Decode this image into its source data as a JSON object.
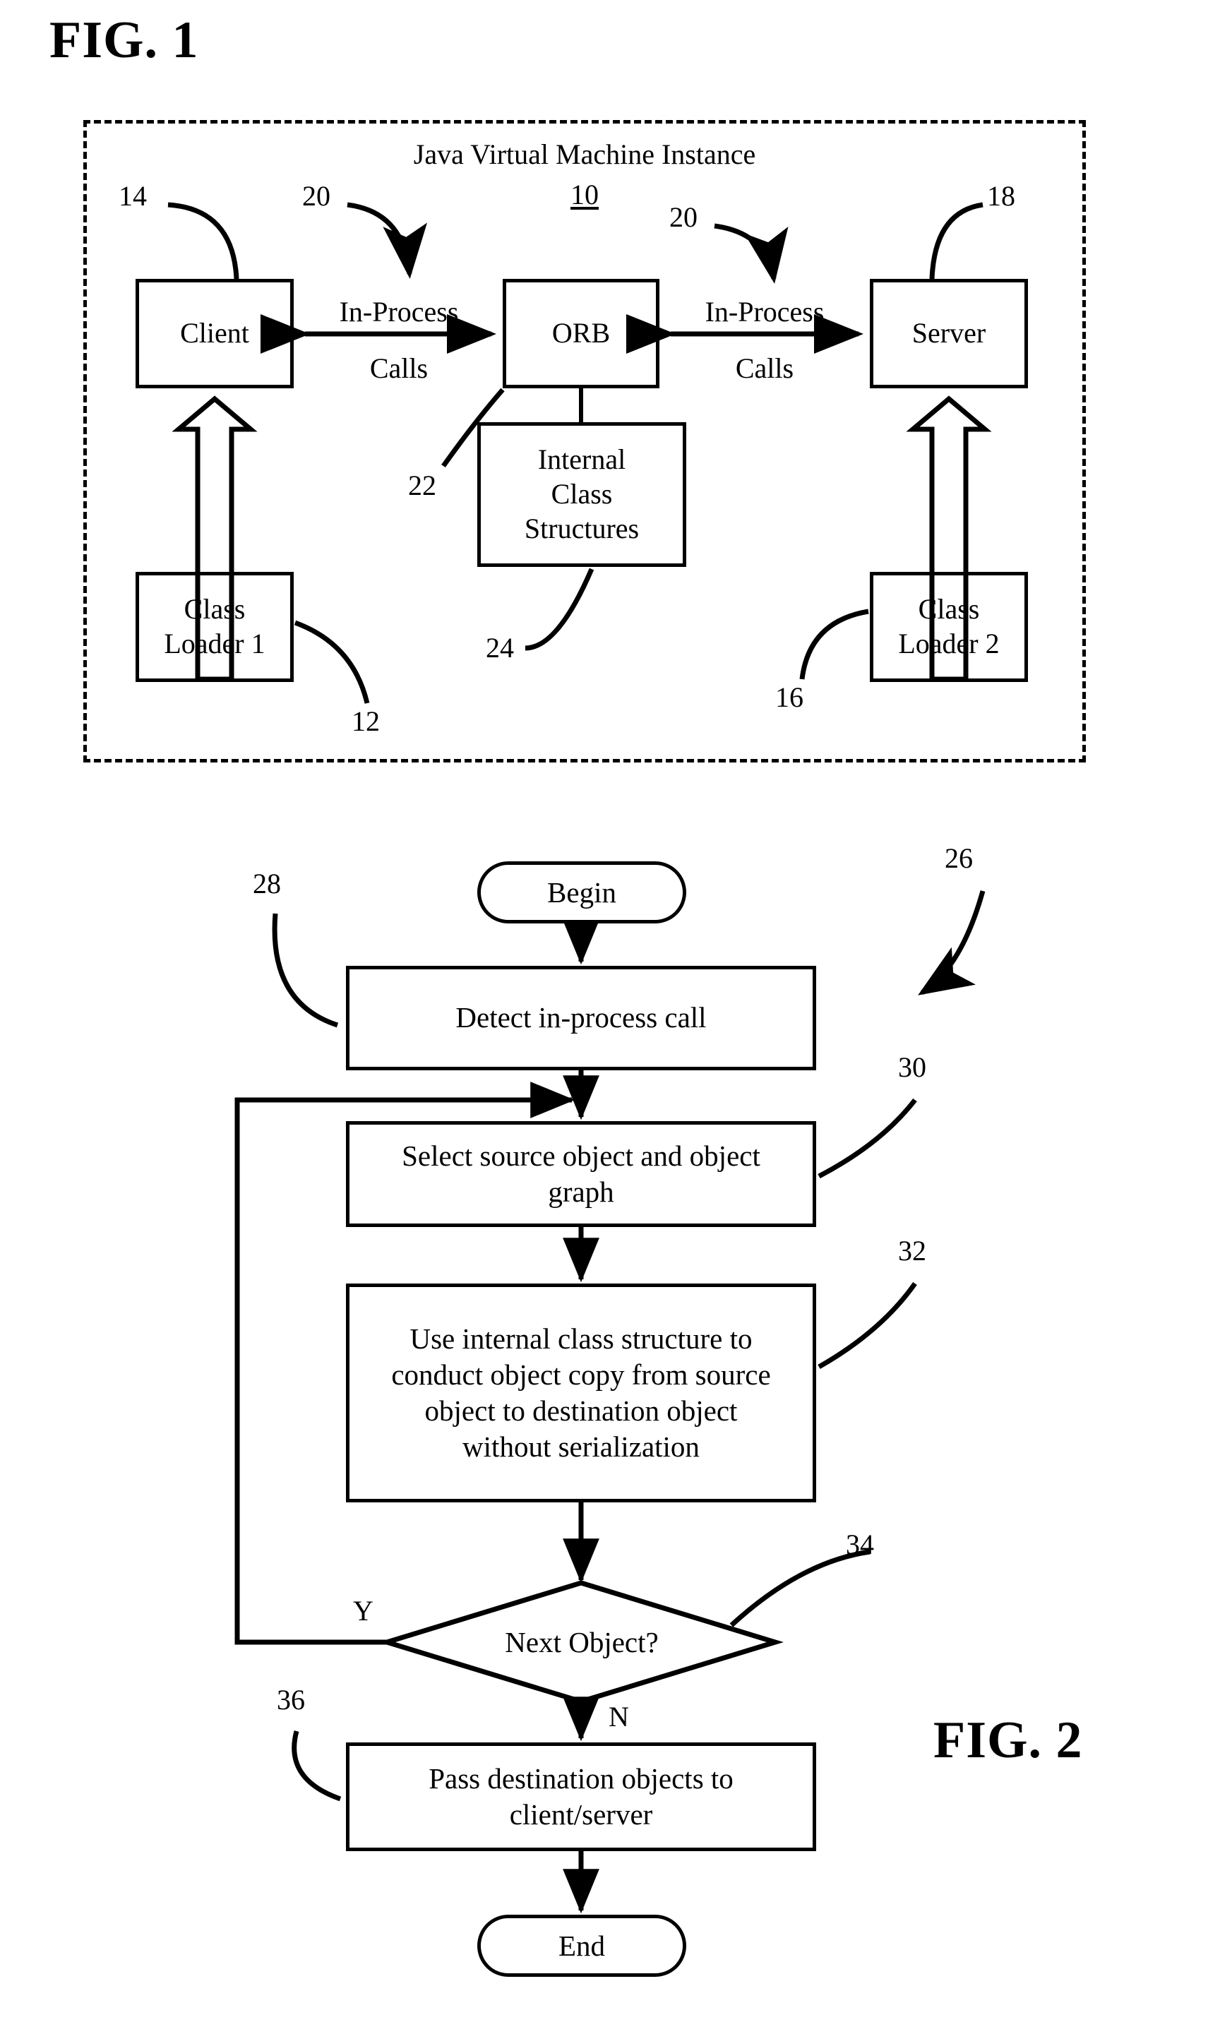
{
  "figures": [
    {
      "title": "FIG. 1"
    },
    {
      "title": "FIG. 2"
    }
  ],
  "fig1": {
    "title": "FIG. 1",
    "container": {
      "label": "Java Virtual Machine Instance",
      "ref": "10"
    },
    "nodes": {
      "client": "Client",
      "orb": "ORB",
      "server": "Server",
      "internal_class_structures": "Internal\nClass\nStructures",
      "internal_class_structures_lines": [
        "Internal",
        "Class",
        "Structures"
      ],
      "class_loader_1": "Class\nLoader 1",
      "class_loader_1_lines": [
        "Class",
        "Loader 1"
      ],
      "class_loader_2": "Class\nLoader 2",
      "class_loader_2_lines": [
        "Class",
        "Loader 2"
      ]
    },
    "edges": {
      "in_process_calls_left_line1": "In-Process",
      "in_process_calls_left_line2": "Calls",
      "in_process_calls_right_line1": "In-Process",
      "in_process_calls_right_line2": "Calls"
    },
    "refs": {
      "client": "14",
      "calls_left": "20",
      "calls_right": "20",
      "server": "18",
      "orb": "22",
      "internal_class_structures": "24",
      "class_loader_1": "12",
      "class_loader_2": "16"
    }
  },
  "fig2": {
    "title": "FIG. 2",
    "nodes": {
      "begin": "Begin",
      "detect": "Detect in-process call",
      "select_line1": "Select source object and object",
      "select_line2": "graph",
      "use_line1": "Use internal class structure to",
      "use_line2": "conduct object copy from source",
      "use_line3": "object to destination object",
      "use_line4": "without serialization",
      "decision": "Next Object?",
      "pass_line1": "Pass destination objects to",
      "pass_line2": "client/server",
      "end": "End"
    },
    "branches": {
      "yes": "Y",
      "no": "N"
    },
    "refs": {
      "flowchart": "26",
      "detect": "28",
      "select": "30",
      "use": "32",
      "decision": "34",
      "pass": "36"
    }
  },
  "colors": {
    "ink": "#000000",
    "paper": "#ffffff"
  }
}
